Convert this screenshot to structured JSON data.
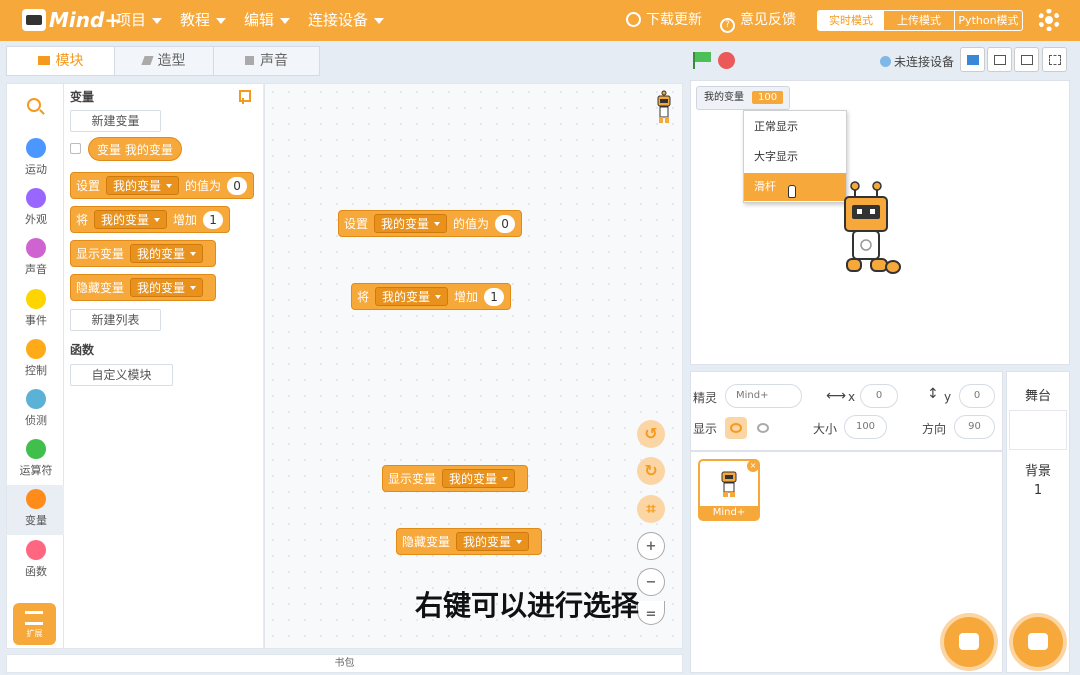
{
  "topbar": {
    "logo_text": "Mind+",
    "menus": [
      "项目",
      "教程",
      "编辑",
      "连接设备"
    ],
    "download_update": "下载更新",
    "feedback": "意见反馈",
    "modes": [
      "实时模式",
      "上传模式",
      "Python模式"
    ],
    "active_mode": "实时模式"
  },
  "tabs": [
    "模块",
    "造型",
    "声音"
  ],
  "categories": [
    {
      "label": "运动",
      "color": "#4c97ff"
    },
    {
      "label": "外观",
      "color": "#9966ff"
    },
    {
      "label": "声音",
      "color": "#cf63cf"
    },
    {
      "label": "事件",
      "color": "#ffd500"
    },
    {
      "label": "控制",
      "color": "#ffab19"
    },
    {
      "label": "侦测",
      "color": "#5cb1d6"
    },
    {
      "label": "运算符",
      "color": "#40bf4a"
    },
    {
      "label": "变量",
      "color": "#ff8c1a"
    },
    {
      "label": "函数",
      "color": "#ff6680"
    }
  ],
  "extension_label": "扩展",
  "palette": {
    "variables_heading": "变量",
    "new_variable": "新建变量",
    "var_reporter": "变量 我的变量",
    "set_block": {
      "prefix": "设置",
      "var": "我的变量",
      "mid": "的值为",
      "value": "0"
    },
    "change_block": {
      "prefix": "将",
      "var": "我的变量",
      "mid": "增加",
      "value": "1"
    },
    "show_block": {
      "prefix": "显示变量",
      "var": "我的变量"
    },
    "hide_block": {
      "prefix": "隐藏变量",
      "var": "我的变量"
    },
    "new_list": "新建列表",
    "functions_heading": "函数",
    "custom_block": "自定义模块"
  },
  "workspace": {
    "set_block": {
      "prefix": "设置",
      "var": "我的变量",
      "mid": "的值为",
      "value": "0"
    },
    "change_block": {
      "prefix": "将",
      "var": "我的变量",
      "mid": "增加",
      "value": "1"
    },
    "show_block": {
      "prefix": "显示变量",
      "var": "我的变量"
    },
    "hide_block": {
      "prefix": "隐藏变量",
      "var": "我的变量"
    },
    "caption": "右键可以进行选择"
  },
  "backpack": "书包",
  "stage": {
    "connection": "未连接设备",
    "monitor": {
      "label": "我的变量",
      "value": "100"
    },
    "context_menu": [
      "正常显示",
      "大字显示",
      "滑杆"
    ],
    "highlighted": "滑杆"
  },
  "sprite_info": {
    "sprite_label": "精灵",
    "sprite_name": "Mind+",
    "x_label": "x",
    "x": "0",
    "y_label": "y",
    "y": "0",
    "show_label": "显示",
    "size_label": "大小",
    "size": "100",
    "direction_label": "方向",
    "direction": "90"
  },
  "sprite_list": [
    {
      "name": "Mind+"
    }
  ],
  "stage_pane": {
    "title": "舞台",
    "backdrop_label": "背景",
    "backdrop_count": "1"
  }
}
